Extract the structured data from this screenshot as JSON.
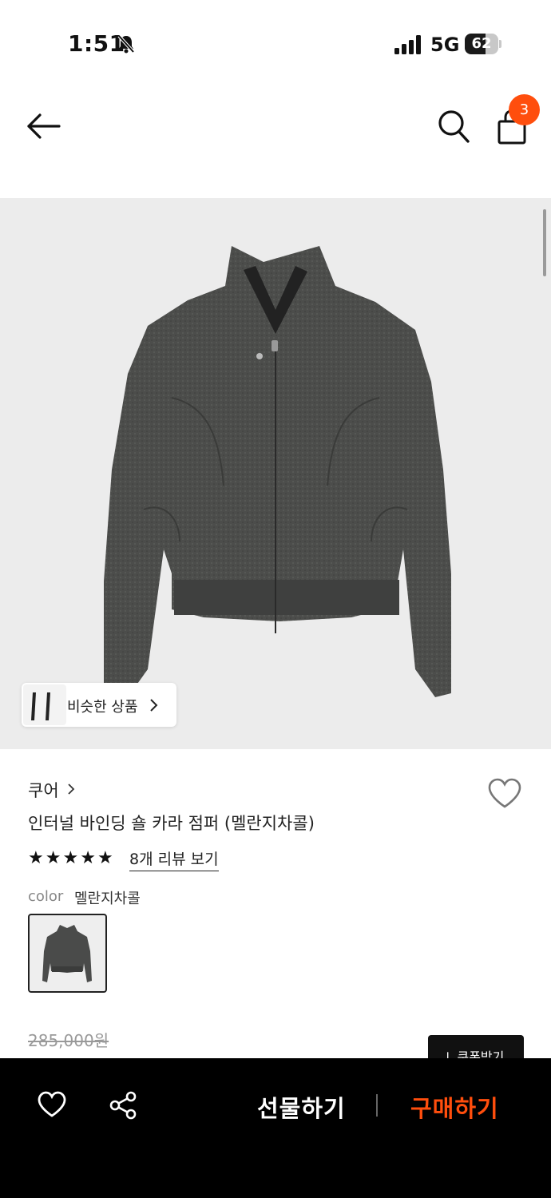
{
  "status_bar": {
    "time": "1:51",
    "network": "5G",
    "battery": "62",
    "battery_level": 0.62
  },
  "header": {
    "cart_count": "3"
  },
  "gallery": {
    "similar_label": "비슷한 상품"
  },
  "product": {
    "brand": "쿠어",
    "title": "인터널 바인딩 숄 카라 점퍼 (멜란지차콜)",
    "rating": 5,
    "review_link": "8개 리뷰 보기",
    "color_label": "color",
    "color_value": "멜란지차콜",
    "original_price": "285,000원",
    "coupon_label": "↓ 쿠폰받기"
  },
  "bottom_bar": {
    "gift_label": "선물하기",
    "buy_label": "구매하기"
  },
  "colors": {
    "accent": "#ff4e0d",
    "bottom_bar_bg": "#000000",
    "jacket": "#4a4b4a"
  }
}
